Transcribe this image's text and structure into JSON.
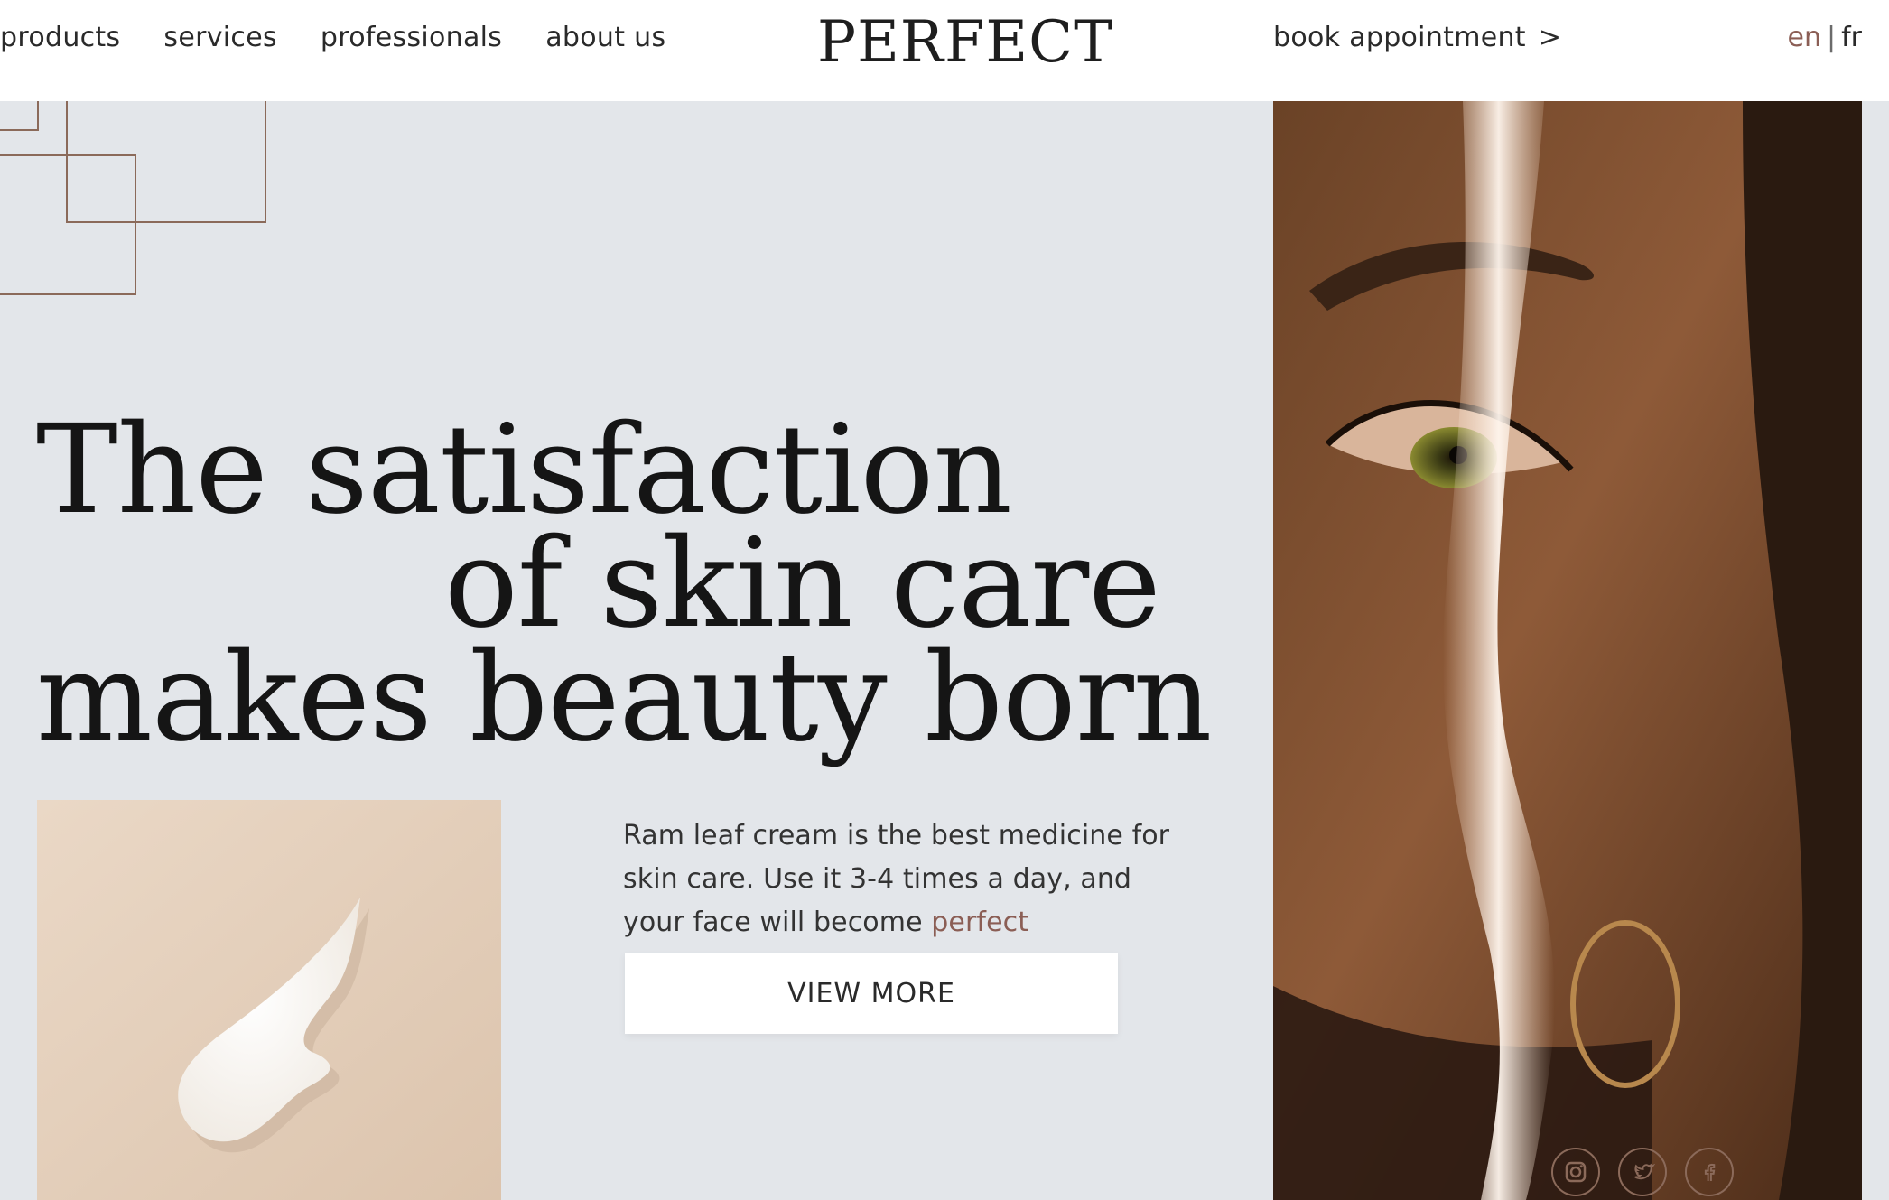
{
  "nav": {
    "items": [
      "products",
      "services",
      "professionals",
      "about us"
    ]
  },
  "brand": {
    "logo": "PERFECT"
  },
  "header": {
    "book_label": "book appointment",
    "book_arrow": ">"
  },
  "lang": {
    "active": "en",
    "separator": "|",
    "other": "fr"
  },
  "hero": {
    "headline_line1": "The satisfaction",
    "headline_line2": "of skin care",
    "headline_line3": "makes beauty born",
    "description_prefix": "Ram leaf cream is the best medicine for skin care. Use it 3-4 times a day, and your face will become ",
    "description_accent": "perfect",
    "cta_label": "VIEW MORE"
  },
  "social": {
    "icons": [
      "instagram-icon",
      "twitter-icon",
      "facebook-icon"
    ]
  },
  "colors": {
    "accent": "#8b5e55",
    "hero_bg": "#e3e6ea",
    "text": "#1f1f1f"
  }
}
